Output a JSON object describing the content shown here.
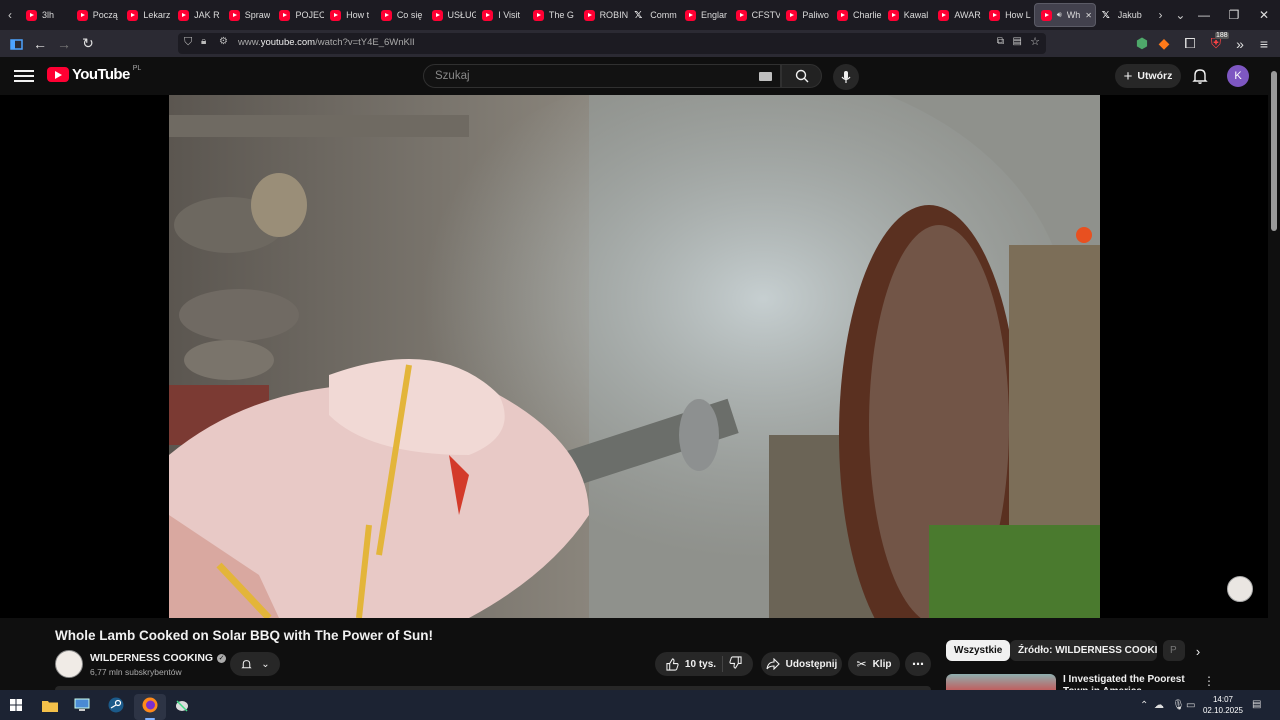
{
  "browser": {
    "tabs": [
      {
        "label": "3lh",
        "icon": "youtube-icon"
      },
      {
        "label": "Począ",
        "icon": "youtube-icon"
      },
      {
        "label": "Lekarz",
        "icon": "youtube-icon"
      },
      {
        "label": "JAK R",
        "icon": "youtube-icon"
      },
      {
        "label": "Spraw",
        "icon": "youtube-icon"
      },
      {
        "label": "POJEC",
        "icon": "youtube-icon"
      },
      {
        "label": "How t",
        "icon": "youtube-icon"
      },
      {
        "label": "Co się",
        "icon": "youtube-icon"
      },
      {
        "label": "USŁUG",
        "icon": "youtube-icon"
      },
      {
        "label": "I Visit",
        "icon": "youtube-icon"
      },
      {
        "label": "The G",
        "icon": "youtube-icon"
      },
      {
        "label": "ROBIN",
        "icon": "youtube-icon"
      },
      {
        "label": "Comm",
        "icon": "x-icon"
      },
      {
        "label": "Englar",
        "icon": "youtube-icon"
      },
      {
        "label": "CFSTV",
        "icon": "youtube-icon"
      },
      {
        "label": "Paliwo",
        "icon": "youtube-icon"
      },
      {
        "label": "Charlie",
        "icon": "youtube-icon"
      },
      {
        "label": "Kawal",
        "icon": "youtube-icon"
      },
      {
        "label": "AWAR",
        "icon": "youtube-icon"
      },
      {
        "label": "How L",
        "icon": "youtube-icon"
      },
      {
        "label": "Wh",
        "icon": "youtube-icon",
        "active": true
      },
      {
        "label": "Jakub",
        "icon": "x-icon"
      }
    ],
    "url_prefix": "www.",
    "url_domain": "youtube.com",
    "url_path": "/watch?v=tY4E_6WnKlI",
    "extension_badge": "188"
  },
  "youtube": {
    "logo_text": "YouTube",
    "country_code": "PL",
    "search_placeholder": "Szukaj",
    "create_label": "Utwórz",
    "avatar_letter": "K"
  },
  "video": {
    "title": "Whole Lamb Cooked on Solar BBQ with The Power of Sun!",
    "channel_name": "WILDERNESS COOKING",
    "subscribers": "6,77 mln subskrybentów",
    "likes": "10 tys.",
    "share_label": "Udostępnij",
    "clip_label": "Klip"
  },
  "sidebar": {
    "chips": [
      "Wszystkie",
      "Źródło: WILDERNESS COOKING",
      "P"
    ],
    "recommendation": {
      "title": "I Investigated the Poorest Town in America"
    }
  },
  "taskbar": {
    "time": "14:07",
    "date": "02.10.2025"
  },
  "colors": {
    "youtube_red": "#ff0033",
    "background": "#0f0f0f",
    "browser_chrome": "#1c1b22",
    "taskbar": "#1c2333"
  }
}
